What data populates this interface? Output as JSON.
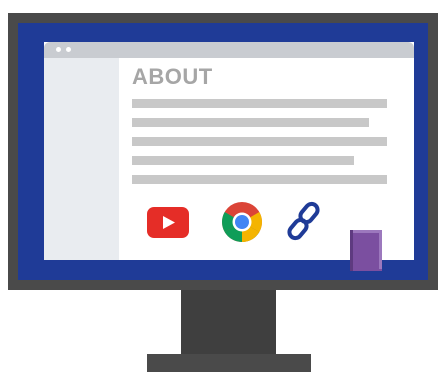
{
  "page": {
    "title": "ABOUT"
  },
  "icons": {
    "video": "youtube-icon",
    "browser": "chrome-icon",
    "link": "link-icon",
    "book": "book-icon"
  },
  "colors": {
    "monitor_frame": "#4a4a4a",
    "screen_background": "#1f3b97",
    "title_text": "#a6a6a6",
    "placeholder_line": "#c8c8c8",
    "sidebar": "#e9ecf0",
    "titlebar": "#c9ccd1",
    "youtube_red": "#e52d27",
    "book_purple": "#7b4fa0"
  }
}
